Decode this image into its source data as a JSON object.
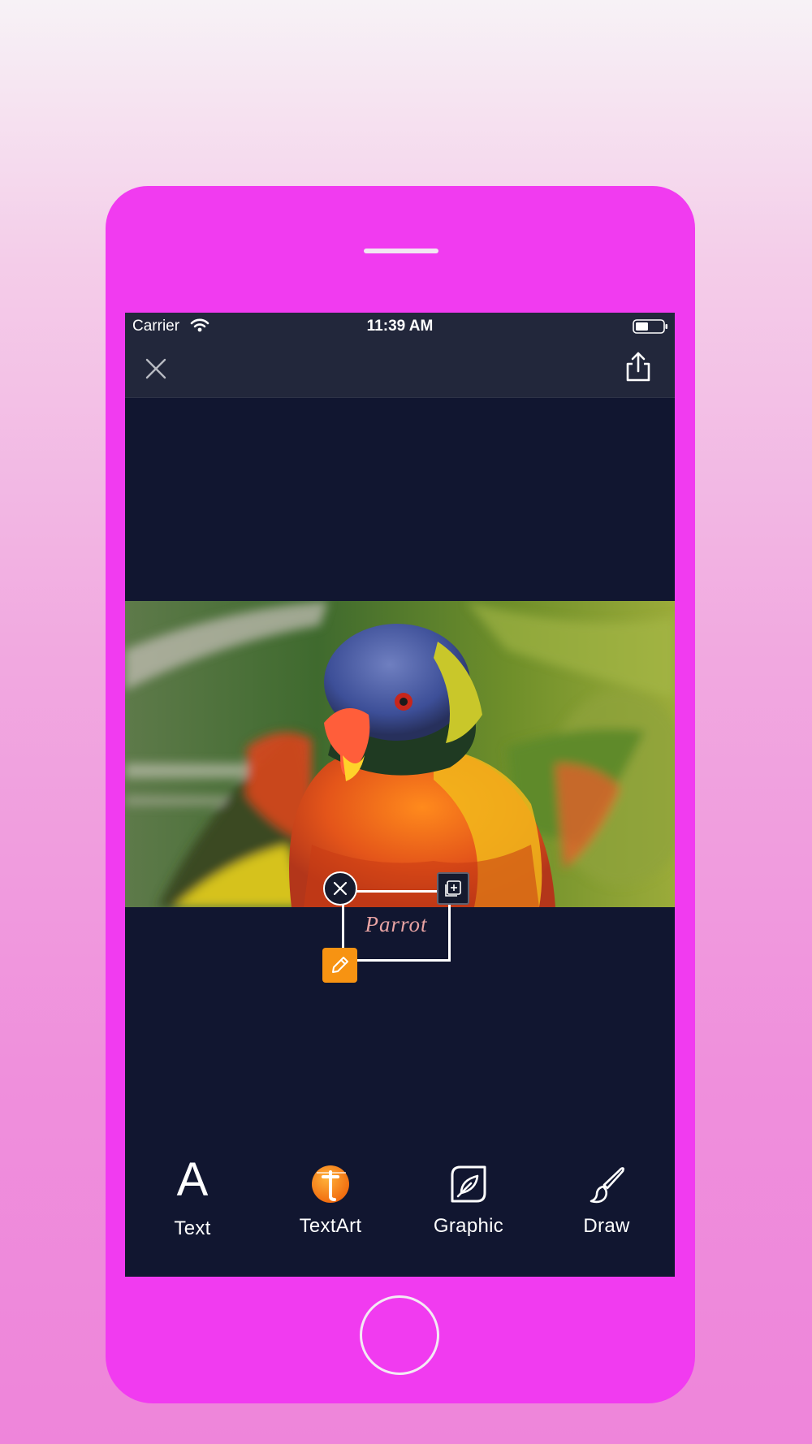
{
  "status_bar": {
    "carrier": "Carrier",
    "time": "11:39 AM"
  },
  "canvas": {
    "sticker_text": "Parrot"
  },
  "toolbar": {
    "items": [
      {
        "label": "Text",
        "icon": "text-letter-icon"
      },
      {
        "label": "TextArt",
        "icon": "textart-icon"
      },
      {
        "label": "Graphic",
        "icon": "graphic-leaf-icon"
      },
      {
        "label": "Draw",
        "icon": "brush-icon"
      }
    ]
  },
  "colors": {
    "phone_body": "#f13bf0",
    "screen_bg": "#111630",
    "nav_bg": "#22273b",
    "edit_accent": "#f79312"
  }
}
